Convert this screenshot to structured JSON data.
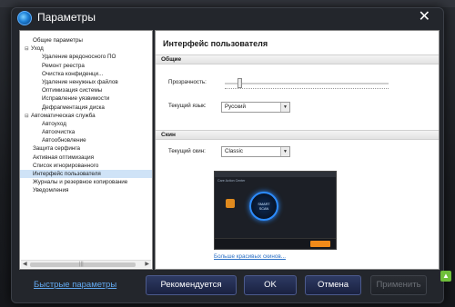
{
  "window": {
    "title": "Параметры"
  },
  "tree": {
    "items": [
      {
        "label": "Общие параметры",
        "level": 0,
        "expander": ""
      },
      {
        "label": "Уход",
        "level": 0,
        "expander": "⊟"
      },
      {
        "label": "Удаление вредоносного ПО",
        "level": 1,
        "expander": ""
      },
      {
        "label": "Ремонт реестра",
        "level": 1,
        "expander": ""
      },
      {
        "label": "Очистка конфиденци...",
        "level": 1,
        "expander": ""
      },
      {
        "label": "Удаление ненужных файлов",
        "level": 1,
        "expander": ""
      },
      {
        "label": "Оптимизация системы",
        "level": 1,
        "expander": ""
      },
      {
        "label": "Исправление уязвимости",
        "level": 1,
        "expander": ""
      },
      {
        "label": "Дефрагментация диска",
        "level": 1,
        "expander": ""
      },
      {
        "label": "Автоматическая служба",
        "level": 0,
        "expander": "⊟"
      },
      {
        "label": "Автоуход",
        "level": 1,
        "expander": ""
      },
      {
        "label": "Автоочистка",
        "level": 1,
        "expander": ""
      },
      {
        "label": "Автообновление",
        "level": 1,
        "expander": ""
      },
      {
        "label": "Защита серфинга",
        "level": 0,
        "expander": ""
      },
      {
        "label": "Активная оптимизация",
        "level": 0,
        "expander": ""
      },
      {
        "label": "Список игнорированного",
        "level": 0,
        "expander": ""
      },
      {
        "label": "Интерфейс пользователя",
        "level": 0,
        "expander": "",
        "selected": true
      },
      {
        "label": "Журналы и резервное копирование",
        "level": 0,
        "expander": ""
      },
      {
        "label": "Уведомления",
        "level": 0,
        "expander": ""
      }
    ]
  },
  "content": {
    "title": "Интерфейс пользователя",
    "general_section": "Общие",
    "transparency_label": "Прозрачность:",
    "transparency_value": 0.08,
    "language_label": "Текущий язык:",
    "language_value": "Русский",
    "skins_section": "Скин",
    "skin_label": "Текущий скин:",
    "skin_value": "Classic",
    "more_skins_link": "Больше красивых скинов...",
    "preview": {
      "tabs": "Care   Action Center",
      "ring_text": "SMART\nSCAN"
    }
  },
  "footer": {
    "quick_settings_link": "Быстрые параметры",
    "recommended_button": "Рекомендуется",
    "ok_button": "OK",
    "cancel_button": "Отмена",
    "apply_button": "Применить"
  }
}
